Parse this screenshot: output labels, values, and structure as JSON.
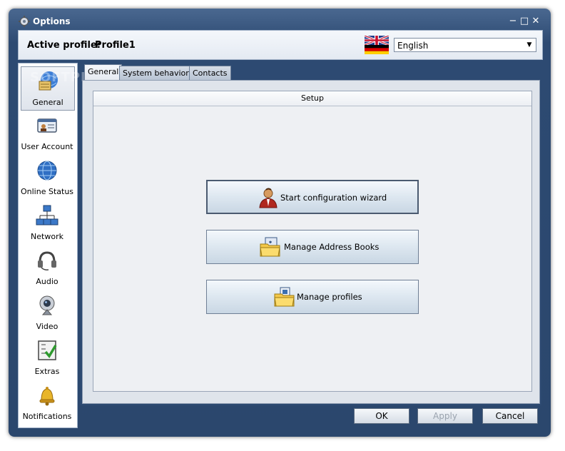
{
  "window": {
    "title": "Options",
    "minimize": "−",
    "maximize": "□",
    "close": "✕"
  },
  "profile": {
    "label": "Active profile:",
    "value": "Profile1",
    "language": "English",
    "flag_icon": "uk-germany-flag-icon"
  },
  "sidebar": {
    "items": [
      {
        "label": "General",
        "icon": "globe-gear-icon",
        "active": true
      },
      {
        "label": "User Account",
        "icon": "id-card-icon"
      },
      {
        "label": "Online Status",
        "icon": "globe-icon"
      },
      {
        "label": "Network",
        "icon": "network-icon"
      },
      {
        "label": "Audio",
        "icon": "headset-icon"
      },
      {
        "label": "Video",
        "icon": "webcam-icon"
      },
      {
        "label": "Extras",
        "icon": "checklist-icon"
      },
      {
        "label": "Notifications",
        "icon": "bell-icon"
      }
    ]
  },
  "tabs": [
    {
      "label": "General",
      "active": true
    },
    {
      "label": "System behavior"
    },
    {
      "label": "Contacts"
    }
  ],
  "setup": {
    "header": "Setup",
    "buttons": [
      {
        "label": "Start configuration wizard",
        "icon": "user-wizard-icon"
      },
      {
        "label": "Manage Address Books",
        "icon": "folder-address-book-icon"
      },
      {
        "label": "Manage profiles",
        "icon": "folder-profile-icon"
      }
    ]
  },
  "footer": {
    "ok": "OK",
    "apply": "Apply",
    "cancel": "Cancel"
  },
  "watermark": "SOFTPEDIA"
}
